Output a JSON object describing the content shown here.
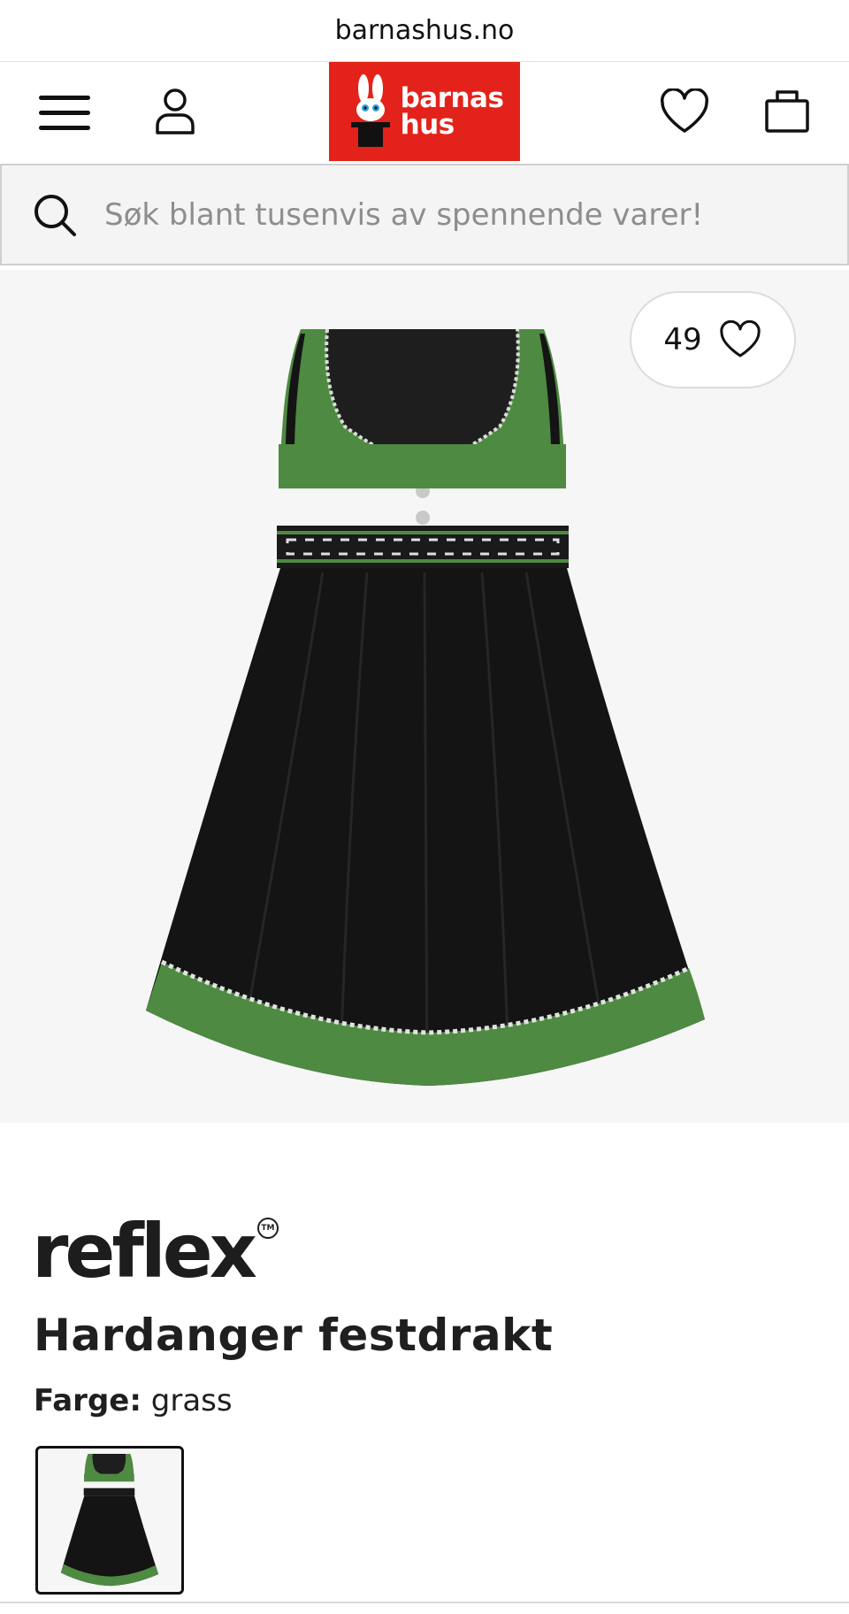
{
  "browser": {
    "url": "barnashus.no"
  },
  "header": {
    "logo_line1": "barnas",
    "logo_line2": "hus",
    "brand_color": "#e3231b",
    "icons": [
      "menu-icon",
      "user-icon",
      "heart-icon",
      "shopping-bag-icon"
    ]
  },
  "search": {
    "placeholder": "Søk blant tusenvis av spennende varer!"
  },
  "product": {
    "like_count": "49",
    "brand": "reflex",
    "title": "Hardanger festdrakt",
    "color_label": "Farge:",
    "color_value": "grass",
    "colors": {
      "green": "#4e8a41",
      "black": "#141414"
    }
  }
}
